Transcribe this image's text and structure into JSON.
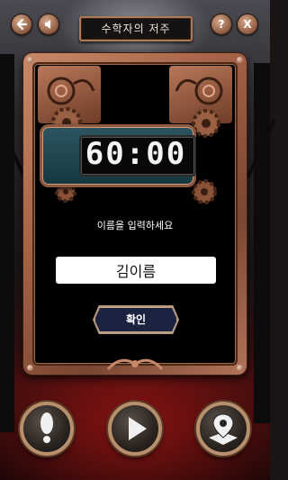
{
  "header": {
    "title": "수학자의 저주",
    "back_icon": "back-arrow-icon",
    "sound_icon": "speaker-icon",
    "help_label": "?",
    "close_label": "X"
  },
  "timer": {
    "minutes": "60",
    "separator": ":",
    "seconds": "00"
  },
  "form": {
    "prompt": "이름을 입력하세요",
    "name_value": "김이름",
    "confirm_label": "확인"
  },
  "bottom_buttons": {
    "hint_icon": "exclamation-icon",
    "play_icon": "play-icon",
    "map_icon": "map-pin-icon"
  },
  "colors": {
    "frame": "#a86448",
    "timer_plate": "#1f4a52",
    "confirm_button": "#1c2340"
  }
}
